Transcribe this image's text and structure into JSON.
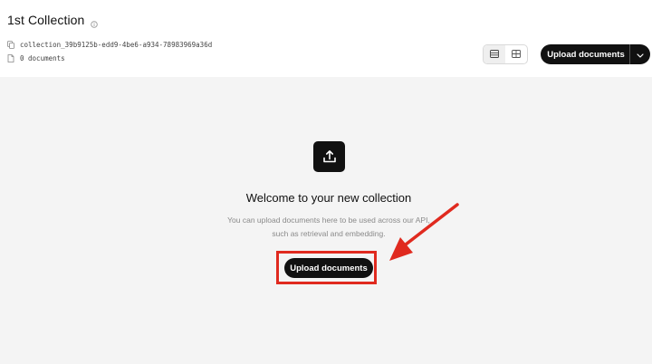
{
  "collection": {
    "title": "1st Collection",
    "id": "collection_39b9125b-edd9-4be6-a934-78983969a36d",
    "documents_count": "0 documents"
  },
  "toolbar": {
    "upload_label": "Upload documents",
    "view_modes": [
      "list",
      "grid"
    ],
    "active_view": "list"
  },
  "empty_state": {
    "heading": "Welcome to your new collection",
    "description": "You can upload documents here to be used across our API, such as retrieval and embedding.",
    "button_label": "Upload documents"
  },
  "colors": {
    "primary": "#111111",
    "annotation": "#e02a1f",
    "background": "#f4f4f4"
  },
  "icons": [
    "info-icon",
    "copy-icon",
    "document-icon",
    "list-view-icon",
    "grid-view-icon",
    "chevron-down-icon",
    "upload-icon"
  ]
}
